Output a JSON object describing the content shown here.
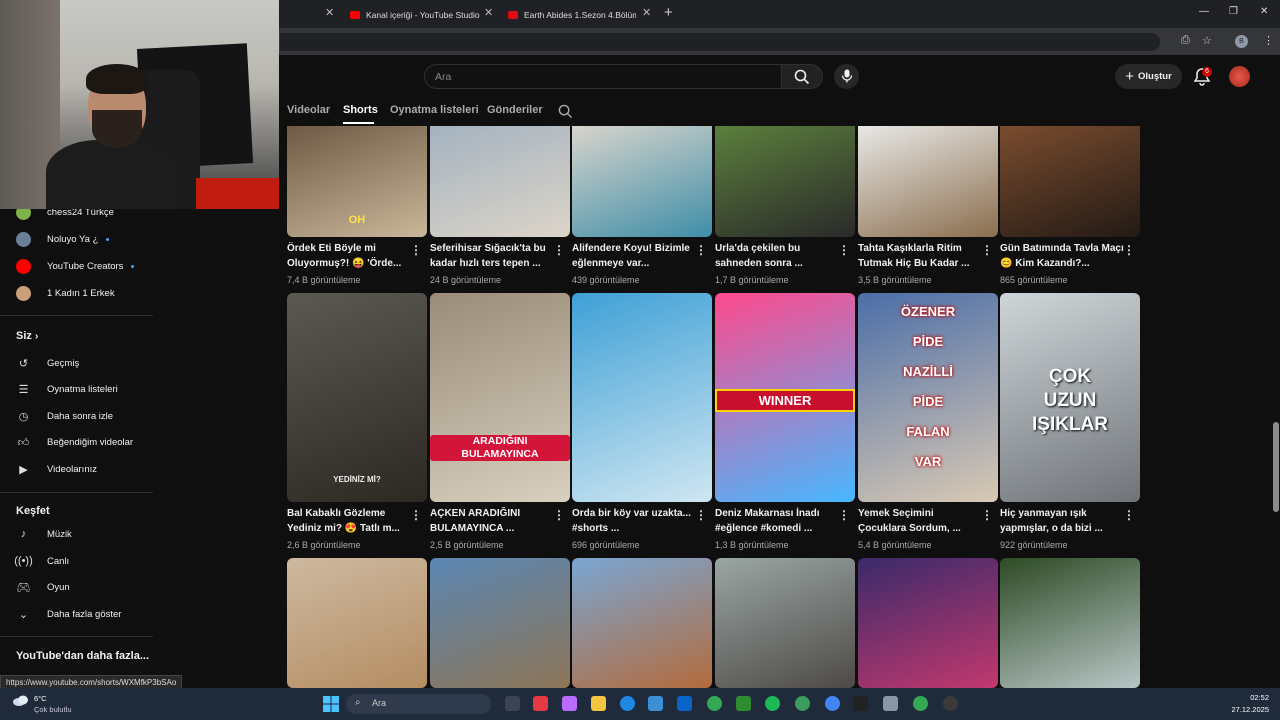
{
  "browser": {
    "tabs": [
      {
        "title": "Kanal içeriği - YouTube Studio",
        "favicon_color": "#ff0000"
      },
      {
        "title": "Earth Abides 1.Sezon 4.Bölüm",
        "favicon_color": "#e50914"
      }
    ],
    "new_tab_icon": "plus-icon",
    "profile_letter": "B"
  },
  "yt_header": {
    "search_placeholder": "Ara",
    "create_label": "Oluştur",
    "notification_count": "6"
  },
  "channel_tabs": [
    {
      "label": "Videolar",
      "active": false
    },
    {
      "label": "Shorts",
      "active": true
    },
    {
      "label": "Oynatma listeleri",
      "active": false
    },
    {
      "label": "Gönderiler",
      "active": false
    }
  ],
  "sidebar": {
    "subscriptions": [
      {
        "label": "chess24 Türkçe",
        "avatar_color": "#7fb24a",
        "live_dot": false
      },
      {
        "label": "Noluyo Ya ¿",
        "avatar_color": "#6a7f9a",
        "live_dot": true
      },
      {
        "label": "YouTube Creators",
        "avatar_color": "#ff0000",
        "live_dot": true
      },
      {
        "label": "1 Kadın 1 Erkek",
        "avatar_color": "#c9a07a",
        "live_dot": false
      }
    ],
    "you_header": "Siz",
    "you_items": [
      {
        "label": "Geçmiş",
        "icon": "history-icon"
      },
      {
        "label": "Oynatma listeleri",
        "icon": "playlist-icon"
      },
      {
        "label": "Daha sonra izle",
        "icon": "clock-icon"
      },
      {
        "label": "Beğendiğim videolar",
        "icon": "thumbs-up-icon"
      },
      {
        "label": "Videolarınız",
        "icon": "video-icon"
      }
    ],
    "explore_header": "Keşfet",
    "explore_items": [
      {
        "label": "Müzik",
        "icon": "music-icon"
      },
      {
        "label": "Canlı",
        "icon": "live-icon"
      },
      {
        "label": "Oyun",
        "icon": "gamepad-icon"
      },
      {
        "label": "Daha fazla göster",
        "icon": "chevron-down-icon"
      }
    ],
    "more_from_youtube": "YouTube'dan daha fazla..."
  },
  "shorts": [
    {
      "title": "Ördek Eti Böyle mi Oluyormuş?! 😝 'Örde...",
      "views": "7,4 B görüntüleme",
      "overlay": "OH",
      "colors": [
        "#6e5a44",
        "#c9b79a"
      ]
    },
    {
      "title": "Seferihisar Sığacık'ta bu kadar hızlı ters tepen ...",
      "views": "24 B görüntüleme",
      "overlay": "",
      "colors": [
        "#a4b3c0",
        "#dcd4c8"
      ]
    },
    {
      "title": "Alifendere Koyu! Bizimle eğlenmeye var...",
      "views": "439 görüntüleme",
      "overlay": "",
      "colors": [
        "#d7d4cc",
        "#3f8ea8"
      ]
    },
    {
      "title": "Urla'da çekilen bu sahneden sonra ...",
      "views": "1,7 B görüntüleme",
      "overlay": "",
      "colors": [
        "#5b7f3c",
        "#2a2a2a"
      ]
    },
    {
      "title": "Tahta Kaşıklarla Ritim Tutmak Hiç Bu Kadar ...",
      "views": "3,5 B görüntüleme",
      "overlay": "",
      "colors": [
        "#e8e8e6",
        "#8b6e4e"
      ]
    },
    {
      "title": "Gün Batımında Tavla Maçı 😊 Kim Kazandı?...",
      "views": "865 görüntüleme",
      "overlay": "",
      "colors": [
        "#7a4c2e",
        "#231a15"
      ]
    },
    {
      "title": "Bal Kabaklı Gözleme Yediniz mi? 😍 Tatlı m...",
      "views": "2,6 B görüntüleme",
      "overlay": "YEDİNİZ Mİ?",
      "colors": [
        "#5a5a52",
        "#2c2822"
      ]
    },
    {
      "title": "AÇKEN ARADIĞINI BULAMAYINCA ...",
      "views": "2,5 B görüntüleme",
      "overlay": "ARADIĞINI\nBULAMAYINCA",
      "colors": [
        "#9a8c78",
        "#d8d0c0"
      ]
    },
    {
      "title": "Orda bir köy var uzakta... #shorts ...",
      "views": "696 görüntüleme",
      "overlay": "",
      "colors": [
        "#3ea0d6",
        "#cfe6f2"
      ]
    },
    {
      "title": "Deniz Makarnası İnadı #eğlence #komedi ...",
      "views": "1,3 B görüntüleme",
      "overlay": "WINNER",
      "colors": [
        "#ff4a8d",
        "#47b8ff"
      ]
    },
    {
      "title": "Yemek Seçimini Çocuklara Sordum, ...",
      "views": "5,4 B görüntüleme",
      "overlay": "ÖZENER\nPİDE\nNAZİLLİ\nPİDE\nFALAN\nVAR",
      "colors": [
        "#4b6ea8",
        "#d9c9b4"
      ]
    },
    {
      "title": "Hiç yanmayan ışık yapmışlar, o da bizi ...",
      "views": "922 görüntüleme",
      "overlay": "ÇOK\nUZUN\nIŞIKLAR",
      "colors": [
        "#cfd5d8",
        "#6f7479"
      ]
    },
    {
      "title": "",
      "views": "",
      "overlay": "",
      "colors": [
        "#cdb9a0",
        "#b58d62"
      ]
    },
    {
      "title": "",
      "views": "",
      "overlay": "",
      "colors": [
        "#5b87b4",
        "#8d7556"
      ]
    },
    {
      "title": "",
      "views": "",
      "overlay": "",
      "colors": [
        "#7aa6d3",
        "#b36b3c"
      ]
    },
    {
      "title": "",
      "views": "",
      "overlay": "",
      "colors": [
        "#9aa6a4",
        "#4e4a46"
      ]
    },
    {
      "title": "",
      "views": "",
      "overlay": "",
      "colors": [
        "#3a2a6a",
        "#c2386e"
      ]
    },
    {
      "title": "",
      "views": "",
      "overlay": "",
      "colors": [
        "#2d4a24",
        "#b8c6c6"
      ]
    }
  ],
  "status_url": "https://www.youtube.com/shorts/WXMfkP3bSAo",
  "taskbar": {
    "temperature": "6°C",
    "condition": "Çok bulutlu",
    "search_placeholder": "Ara",
    "time": "02:52",
    "date": "27.12.2025"
  }
}
